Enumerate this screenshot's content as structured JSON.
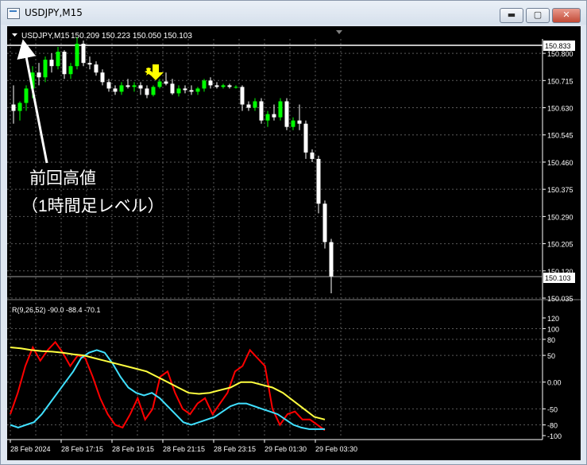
{
  "window": {
    "title": "USDJPY,M15",
    "buttons": {
      "minimize": "▬",
      "maximize": "▢",
      "close": "✕"
    }
  },
  "main_panel": {
    "symbol_label": "USDJPY,M15",
    "ohlc_label": "150.209 150.223 150.050 150.103",
    "price_ticks": [
      "150.800",
      "150.715",
      "150.630",
      "150.545",
      "150.460",
      "150.375",
      "150.290",
      "150.205",
      "150.120",
      "150.035"
    ],
    "high_line_label": "150.833",
    "current_price_label": "150.103",
    "annotation_line1": "前回高値",
    "annotation_line2": "（1時間足レベル）"
  },
  "indicator_panel": {
    "label": "R(9,26,52) -90.0 -88.4 -70.1",
    "ticks": [
      "120",
      "100",
      "80",
      "50",
      "0.00",
      "-50",
      "-80",
      "-100"
    ]
  },
  "time_axis": [
    "28 Feb 2024",
    "28 Feb 17:15",
    "28 Feb 19:15",
    "28 Feb 21:15",
    "28 Feb 23:15",
    "29 Feb 01:30",
    "29 Feb 03:30"
  ],
  "colors": {
    "background": "#000000",
    "bull": "#00ff00",
    "bear": "#ffffff",
    "red_line": "#ff0000",
    "cyan_line": "#40e0ff",
    "yellow_line": "#ffff40",
    "signal_arrow": "#ffff00"
  },
  "chart_data": [
    {
      "type": "candlestick",
      "title": "USDJPY,M15",
      "y_range": [
        150.035,
        150.84
      ],
      "ohlc_note": "candles estimated left to right (15-minute bars)",
      "candles": [
        [
          150.64,
          150.7,
          150.58,
          150.62
        ],
        [
          150.62,
          150.65,
          150.59,
          150.645
        ],
        [
          150.645,
          150.7,
          150.62,
          150.69
        ],
        [
          150.69,
          150.76,
          150.66,
          150.74
        ],
        [
          150.74,
          150.77,
          150.7,
          150.725
        ],
        [
          150.725,
          150.79,
          150.71,
          150.78
        ],
        [
          150.78,
          150.8,
          150.74,
          150.76
        ],
        [
          150.76,
          150.82,
          150.75,
          150.805
        ],
        [
          150.805,
          150.81,
          150.72,
          150.735
        ],
        [
          150.735,
          150.77,
          150.72,
          150.76
        ],
        [
          150.76,
          150.85,
          150.75,
          150.83
        ],
        [
          150.83,
          150.84,
          150.76,
          150.77
        ],
        [
          150.77,
          150.79,
          150.75,
          150.765
        ],
        [
          150.765,
          150.775,
          150.73,
          150.74
        ],
        [
          150.74,
          150.75,
          150.7,
          150.71
        ],
        [
          150.71,
          150.72,
          150.68,
          150.69
        ],
        [
          150.69,
          150.7,
          150.67,
          150.68
        ],
        [
          150.68,
          150.71,
          150.67,
          150.7
        ],
        [
          150.7,
          150.72,
          150.69,
          150.695
        ],
        [
          150.695,
          150.71,
          150.68,
          150.7
        ],
        [
          150.7,
          150.71,
          150.67,
          150.69
        ],
        [
          150.69,
          150.7,
          150.66,
          150.67
        ],
        [
          150.67,
          150.7,
          150.665,
          150.695
        ],
        [
          150.695,
          150.72,
          150.69,
          150.712
        ],
        [
          150.712,
          150.74,
          150.7,
          150.705
        ],
        [
          150.705,
          150.72,
          150.67,
          150.675
        ],
        [
          150.675,
          150.7,
          150.665,
          150.69
        ],
        [
          150.69,
          150.7,
          150.675,
          150.685
        ],
        [
          150.685,
          150.7,
          150.67,
          150.68
        ],
        [
          150.68,
          150.695,
          150.67,
          150.69
        ],
        [
          150.69,
          150.72,
          150.68,
          150.715
        ],
        [
          150.715,
          150.725,
          150.69,
          150.7
        ],
        [
          150.7,
          150.71,
          150.69,
          150.695
        ],
        [
          150.695,
          150.705,
          150.69,
          150.7
        ],
        [
          150.7,
          150.705,
          150.69,
          150.695
        ],
        [
          150.695,
          150.7,
          150.69,
          150.695
        ],
        [
          150.695,
          150.7,
          150.62,
          150.64
        ],
        [
          150.64,
          150.65,
          150.62,
          150.63
        ],
        [
          150.63,
          150.66,
          150.62,
          150.65
        ],
        [
          150.65,
          150.66,
          150.58,
          150.59
        ],
        [
          150.59,
          150.62,
          150.57,
          150.61
        ],
        [
          150.61,
          150.64,
          150.59,
          150.6
        ],
        [
          150.6,
          150.66,
          150.59,
          150.65
        ],
        [
          150.65,
          150.66,
          150.56,
          150.57
        ],
        [
          150.57,
          150.6,
          150.56,
          150.59
        ],
        [
          150.59,
          150.64,
          150.56,
          150.58
        ],
        [
          150.58,
          150.59,
          150.47,
          150.49
        ],
        [
          150.49,
          150.5,
          150.46,
          150.47
        ],
        [
          150.47,
          150.48,
          150.3,
          150.33
        ],
        [
          150.33,
          150.34,
          150.19,
          150.21
        ],
        [
          150.21,
          150.22,
          150.05,
          150.103
        ]
      ],
      "annotations": [
        "前回高値",
        "（1時間足レベル）"
      ]
    },
    {
      "type": "line",
      "title": "R(9,26,52)",
      "ylim": [
        -100,
        120
      ],
      "series": [
        {
          "values": [
            -60,
            -20,
            30,
            65,
            40,
            60,
            75,
            55,
            30,
            50,
            45,
            10,
            -30,
            -60,
            -80,
            -85,
            -60,
            -30,
            -70,
            -50,
            10,
            20,
            -20,
            -50,
            -60,
            -40,
            -30,
            -60,
            -40,
            -20,
            20,
            30,
            60,
            45,
            30,
            -50,
            -80,
            -60,
            -55,
            -70,
            -70,
            -80,
            -90
          ]
        },
        {
          "values": [
            -80,
            -85,
            -80,
            -75,
            -60,
            -40,
            -20,
            0,
            20,
            45,
            55,
            60,
            55,
            35,
            10,
            -10,
            -20,
            -25,
            -20,
            -30,
            -45,
            -60,
            -75,
            -80,
            -75,
            -70,
            -65,
            -55,
            -45,
            -40,
            -40,
            -45,
            -50,
            -55,
            -60,
            -70,
            -80,
            -85,
            -88,
            -88,
            -88
          ]
        },
        {
          "values": [
            65,
            63,
            60,
            58,
            57,
            55,
            52,
            50,
            45,
            40,
            35,
            30,
            25,
            20,
            10,
            0,
            -10,
            -20,
            -22,
            -20,
            -15,
            -10,
            0,
            0,
            -5,
            -10,
            -20,
            -35,
            -50,
            -65,
            -70
          ]
        }
      ]
    }
  ]
}
